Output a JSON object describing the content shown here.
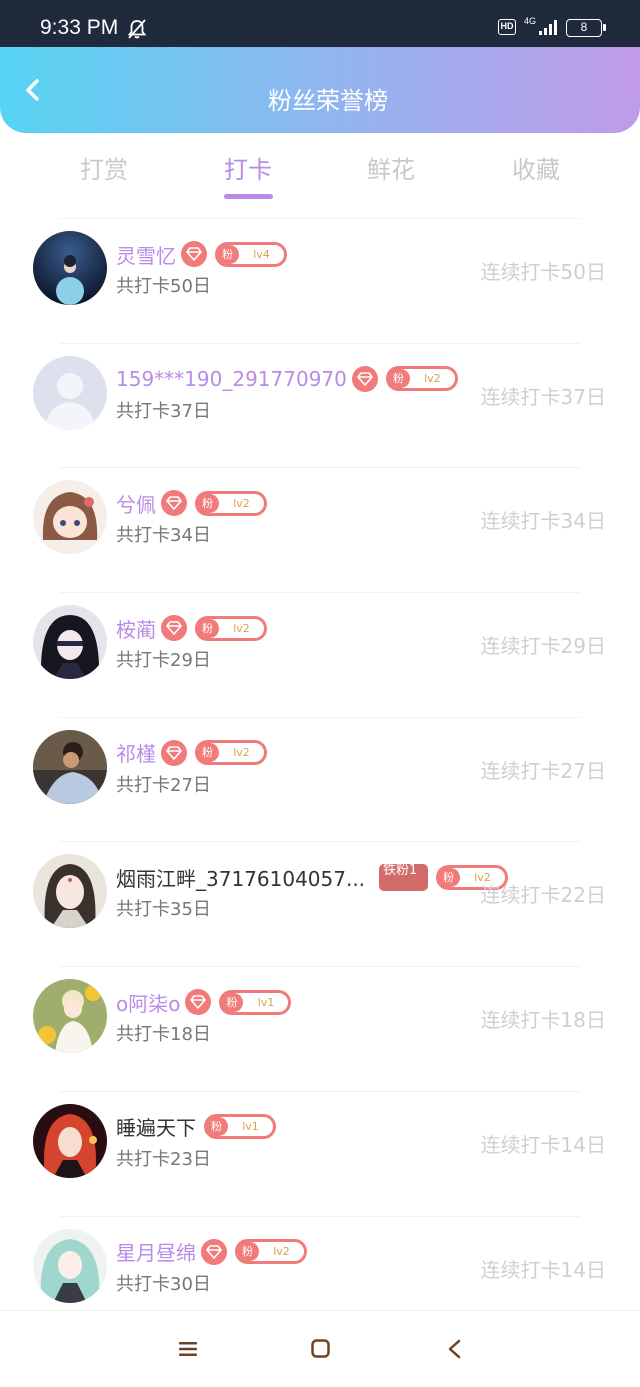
{
  "status_bar": {
    "time": "9:33 PM",
    "hd": "HD",
    "network": "4G",
    "battery": "8",
    "icons": [
      "bell-off-icon",
      "signal-icon"
    ]
  },
  "header": {
    "title": "粉丝荣誉榜",
    "back_icon": "chevron-left-icon"
  },
  "tabs": [
    {
      "label": "打赏",
      "active": false
    },
    {
      "label": "打卡",
      "active": true
    },
    {
      "label": "鲜花",
      "active": false
    },
    {
      "label": "收藏",
      "active": false
    }
  ],
  "fans": [
    {
      "name": "灵雪忆",
      "name_color": "purple",
      "diamond": true,
      "fan_tag": "粉",
      "level": "lv4",
      "total": "共打卡50日",
      "streak": "连续打卡50日"
    },
    {
      "name": "159***190_291770970",
      "name_color": "purple",
      "diamond": true,
      "fan_tag": "粉",
      "level": "lv2",
      "total": "共打卡37日",
      "streak": "连续打卡37日"
    },
    {
      "name": "兮佩",
      "name_color": "purple",
      "diamond": true,
      "fan_tag": "粉",
      "level": "lv2",
      "total": "共打卡34日",
      "streak": "连续打卡34日"
    },
    {
      "name": "桉蔺",
      "name_color": "purple",
      "diamond": true,
      "fan_tag": "粉",
      "level": "lv2",
      "total": "共打卡29日",
      "streak": "连续打卡29日"
    },
    {
      "name": "祁槿",
      "name_color": "purple",
      "diamond": true,
      "fan_tag": "粉",
      "level": "lv2",
      "total": "共打卡27日",
      "streak": "连续打卡27日"
    },
    {
      "name": "烟雨江畔_37176104057...",
      "name_color": "dark",
      "diamond": false,
      "iron_badge": "铁粉1",
      "fan_tag": "粉",
      "level": "lv2",
      "total": "共打卡35日",
      "streak": "连续打卡22日"
    },
    {
      "name": "o阿柒o",
      "name_color": "purple",
      "diamond": true,
      "fan_tag": "粉",
      "level": "lv1",
      "total": "共打卡18日",
      "streak": "连续打卡18日"
    },
    {
      "name": "睡遍天下",
      "name_color": "dark",
      "diamond": false,
      "fan_tag": "粉",
      "level": "lv1",
      "total": "共打卡23日",
      "streak": "连续打卡14日"
    },
    {
      "name": "星月昼绵",
      "name_color": "purple",
      "diamond": true,
      "fan_tag": "粉",
      "level": "lv2",
      "total": "共打卡30日",
      "streak": "连续打卡14日"
    }
  ],
  "colors": {
    "accent": "#b98be8",
    "badge": "#f17b7b",
    "header_start": "#56d4f3",
    "header_end": "#c09be9"
  },
  "nav_bar": {
    "icons": [
      "menu-icon",
      "home-icon",
      "back-icon"
    ]
  }
}
